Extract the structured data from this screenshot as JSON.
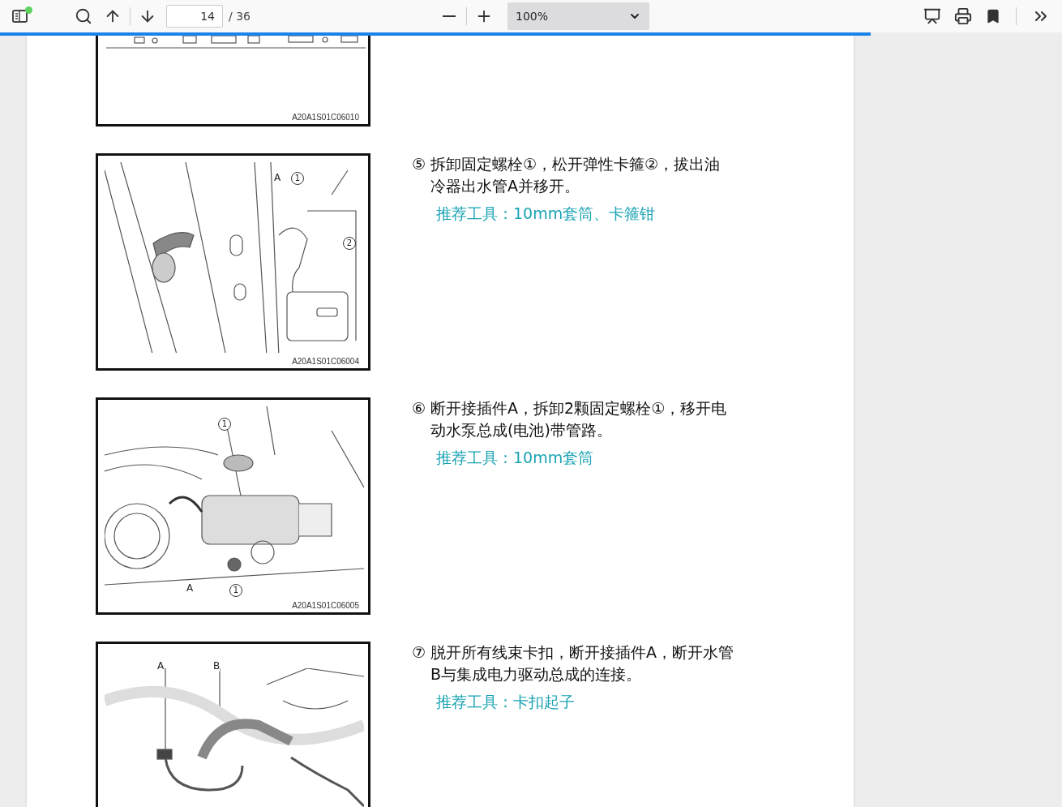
{
  "toolbar": {
    "sidebar_notification": true,
    "page_input": {
      "value": "14"
    },
    "page_count": "/ 36",
    "zoom": {
      "value": "100%"
    }
  },
  "progress": {
    "level": 0.82
  },
  "items": [
    {
      "figure": {
        "code": "A20A1S01C06010",
        "cropped_top": true
      }
    },
    {
      "figure": {
        "code": "A20A1S01C06004",
        "callouts": [
          {
            "label": "A",
            "kind": "plain"
          },
          {
            "label": "1",
            "kind": "circled"
          },
          {
            "label": "2",
            "kind": "circled"
          }
        ]
      },
      "step": {
        "number": "⑤",
        "text": "拆卸固定螺栓①，松开弹性卡箍②，拔出油冷器出水管A并移开。",
        "tool": "推荐工具：10mm套筒、卡箍钳"
      }
    },
    {
      "figure": {
        "code": "A20A1S01C06005",
        "callouts": [
          {
            "label": "1",
            "kind": "circled"
          },
          {
            "label": "A",
            "kind": "plain"
          },
          {
            "label": "1",
            "kind": "circled"
          }
        ]
      },
      "step": {
        "number": "⑥",
        "text": "断开接插件A，拆卸2颗固定螺栓①，移开电动水泵总成(电池)带管路。",
        "tool": "推荐工具：10mm套筒"
      }
    },
    {
      "figure": {
        "callouts": [
          {
            "label": "A",
            "kind": "plain"
          },
          {
            "label": "B",
            "kind": "plain"
          }
        ]
      },
      "step": {
        "number": "⑦",
        "text": "脱开所有线束卡扣，断开接插件A，断开水管B与集成电力驱动总成的连接。",
        "tool": "推荐工具：卡扣起子"
      }
    }
  ]
}
